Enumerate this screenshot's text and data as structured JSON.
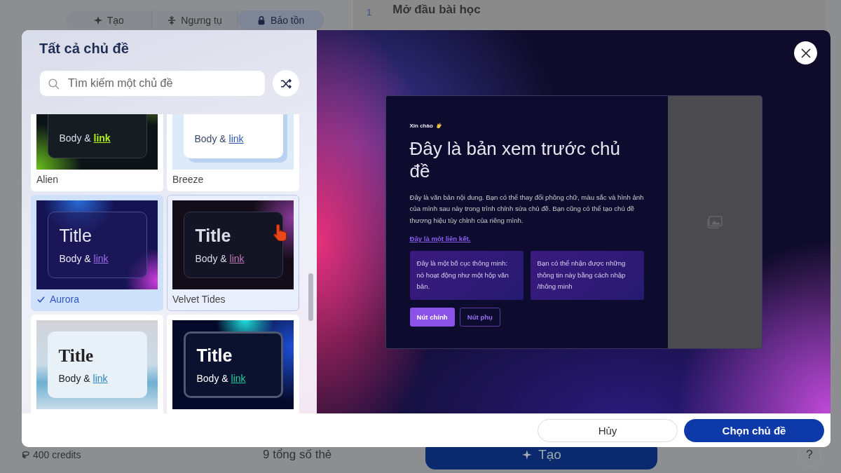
{
  "background": {
    "modes": [
      {
        "label": "Tạo",
        "kind": "create",
        "selected": false
      },
      {
        "label": "Ngưng tụ",
        "kind": "condense",
        "selected": false
      },
      {
        "label": "Bảo tồn",
        "kind": "preserve",
        "selected": true
      }
    ],
    "outline": {
      "number": "1",
      "heading": "Mở đầu bài học"
    },
    "credits": "400 credits",
    "card_count": "9 tổng số thẻ",
    "generate_button": "Tạo",
    "help_button": "?"
  },
  "dialog": {
    "title": "Tất cả chủ đề",
    "search": {
      "placeholder": "Tìm kiếm một chủ đề"
    },
    "themes": [
      {
        "name": "Alien",
        "kind": "alien",
        "body": "Body &",
        "link": "link",
        "selected": false,
        "hovered": false
      },
      {
        "name": "Breeze",
        "kind": "breeze",
        "body": "Body &",
        "link": "link",
        "selected": false,
        "hovered": false
      },
      {
        "name": "Aurora",
        "kind": "aurora",
        "title": "Title",
        "body": "Body &",
        "link": "link",
        "selected": true,
        "hovered": false
      },
      {
        "name": "Velvet Tides",
        "kind": "velvet",
        "title": "Title",
        "body": "Body &",
        "link": "link",
        "selected": false,
        "hovered": true
      },
      {
        "kind": "mist",
        "title": "Title",
        "body": "Body &",
        "link": "link",
        "selected": false,
        "hovered": false
      },
      {
        "kind": "neon",
        "title": "Title",
        "body": "Body &",
        "link": "link",
        "selected": false,
        "hovered": false
      }
    ],
    "preview": {
      "greeting": "Xin chào",
      "heading": "Đây là bản xem trước chủ đề",
      "paragraph": "Đây là văn bản nội dung. Bạn có thể thay đổi phông chữ, màu sắc và hình ảnh của mình sau này trong trình chỉnh sửa chủ đề. Bạn cũng có thể tạo chủ đề thương hiệu tùy chỉnh của riêng mình.",
      "link": "Đây là một liên kết.",
      "boxes": [
        "Đây là một bố cục thông minh: nó hoạt động như một hộp văn bản.",
        "Bạn có thể nhận được những thông tin này bằng cách nhập /thông minh"
      ],
      "primary_button": "Nút chính",
      "secondary_button": "Nút phụ"
    },
    "cancel_button": "Hủy",
    "confirm_button": "Chọn chủ đề"
  }
}
